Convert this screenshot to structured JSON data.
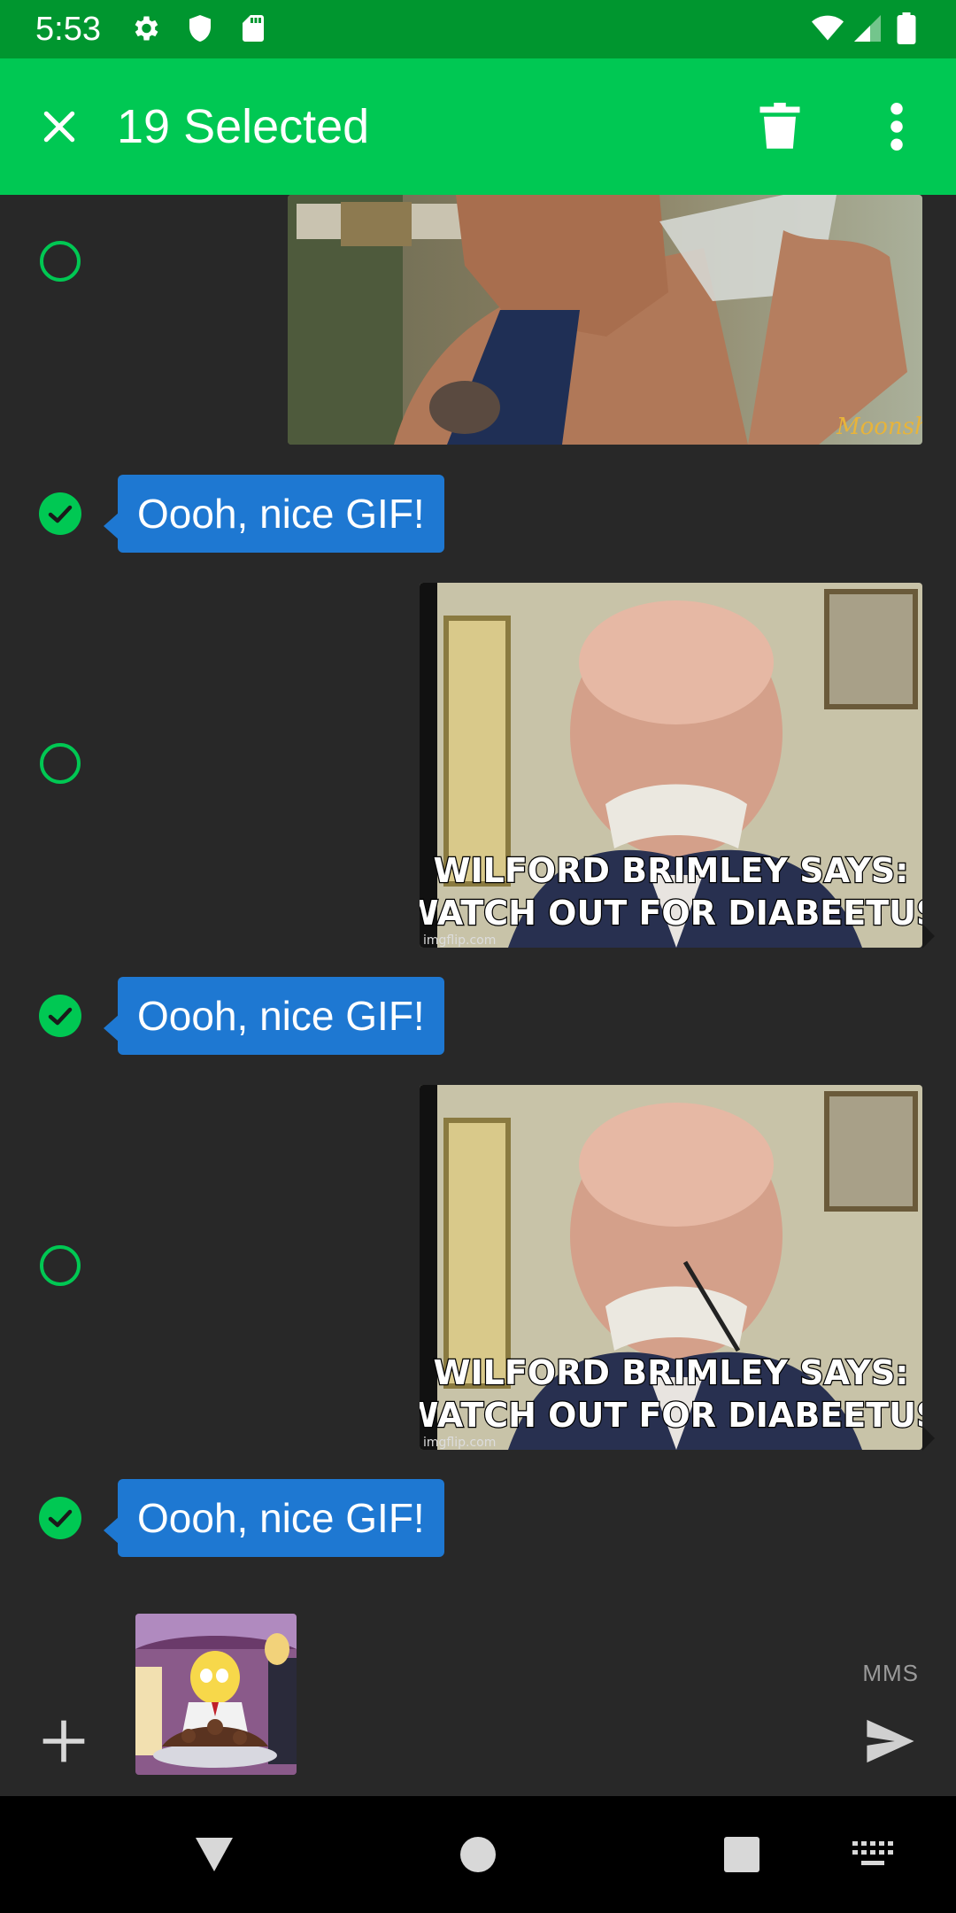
{
  "status_bar": {
    "time": "5:53",
    "left_icons": [
      "gear-icon",
      "shield-icon",
      "sd-card-icon"
    ],
    "right_icons": [
      "wifi-icon",
      "cell-signal-icon",
      "battery-icon"
    ],
    "background": "#00962f"
  },
  "action_bar": {
    "title": "19 Selected",
    "background": "#00c853",
    "actions": [
      "close-icon",
      "trash-icon",
      "more-vert-icon"
    ]
  },
  "messages": [
    {
      "type": "gif",
      "selected": false,
      "content": "partial gif: man drinking from a water bottle",
      "watermark": "Moonshiners"
    },
    {
      "type": "text",
      "selected": true,
      "text": "Oooh, nice GIF!"
    },
    {
      "type": "gif",
      "selected": false,
      "caption_line1": "WILFORD BRIMLEY SAYS:",
      "caption_line2": "WATCH OUT FOR DIABEETUS",
      "watermark": "imgflip.com"
    },
    {
      "type": "text",
      "selected": true,
      "text": "Oooh, nice GIF!"
    },
    {
      "type": "gif",
      "selected": false,
      "caption_line1": "WILFORD BRIMLEY SAYS:",
      "caption_line2": "WATCH OUT FOR DIABEETUS",
      "watermark": "imgflip.com"
    },
    {
      "type": "text",
      "selected": true,
      "text": "Oooh, nice GIF!"
    }
  ],
  "composer": {
    "attachment": "cartoon gif thumbnail",
    "mms_label": "MMS",
    "add_icon": "plus-icon",
    "send_icon": "send-icon"
  },
  "nav_bar": {
    "buttons": [
      "back-triangle-icon",
      "home-circle-icon",
      "recents-square-icon",
      "keyboard-icon"
    ]
  },
  "colors": {
    "accent": "#00c853",
    "bubble": "#1e78d2",
    "background": "#282828"
  }
}
